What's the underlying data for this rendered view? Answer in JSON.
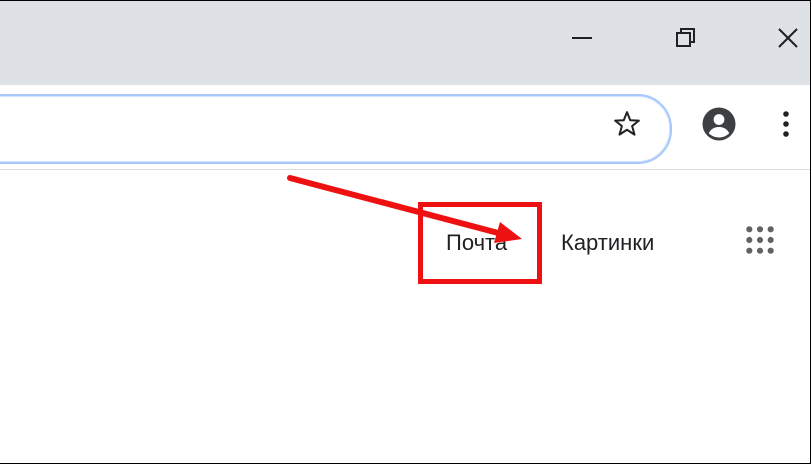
{
  "window": {
    "controls": {
      "minimize_icon": "minimize-icon",
      "restore_icon": "restore-icon",
      "close_icon": "close-icon"
    },
    "titlebar_color": "#dee1e6"
  },
  "toolbar": {
    "omnibox_border_color": "#a8c7fa",
    "bookmark_icon": "star-icon",
    "profile_icon": "account-circle-icon",
    "menu_icon": "vertical-dots-icon"
  },
  "header_links": {
    "mail": "Почта",
    "images": "Картинки",
    "apps_icon": "grid-dots-icon"
  },
  "annotation": {
    "highlight_color": "#ee1111",
    "arrow_color": "#ee1111"
  }
}
